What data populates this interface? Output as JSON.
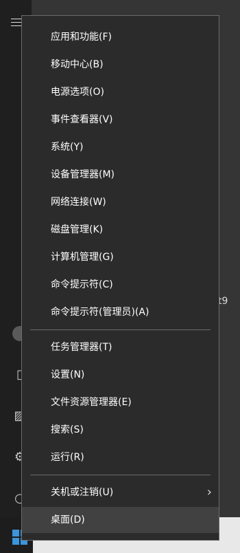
{
  "menu": {
    "items": [
      {
        "label": "应用和功能(F)"
      },
      {
        "label": "移动中心(B)"
      },
      {
        "label": "电源选项(O)"
      },
      {
        "label": "事件查看器(V)"
      },
      {
        "label": "系统(Y)"
      },
      {
        "label": "设备管理器(M)"
      },
      {
        "label": "网络连接(W)"
      },
      {
        "label": "磁盘管理(K)"
      },
      {
        "label": "计算机管理(G)"
      },
      {
        "label": "命令提示符(C)"
      },
      {
        "label": "命令提示符(管理员)(A)"
      },
      {
        "label": "任务管理器(T)"
      },
      {
        "label": "设置(N)"
      },
      {
        "label": "文件资源管理器(E)"
      },
      {
        "label": "搜索(S)"
      },
      {
        "label": "运行(R)"
      },
      {
        "label": "关机或注销(U)"
      },
      {
        "label": "桌面(D)"
      }
    ]
  },
  "background": {
    "partial_text": "t9"
  },
  "colors": {
    "menu_bg": "#2b2b2b",
    "menu_border": "#6b6b6b",
    "hover_bg": "#414141",
    "windows_blue": "#3a96dd"
  }
}
